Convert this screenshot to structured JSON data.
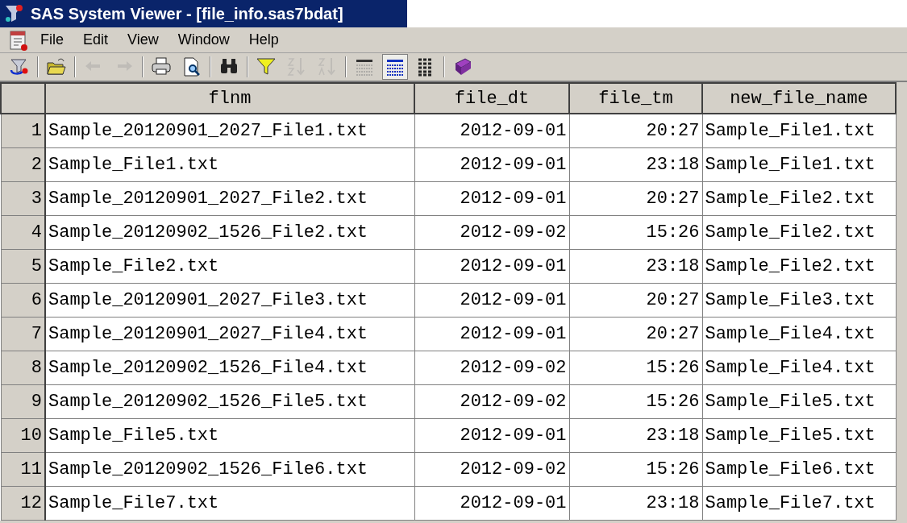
{
  "window": {
    "title": "SAS System Viewer - [file_info.sas7bdat]"
  },
  "menu": [
    "File",
    "Edit",
    "View",
    "Window",
    "Help"
  ],
  "toolbar": [
    {
      "kind": "explorer",
      "disabled": false
    },
    {
      "kind": "sep"
    },
    {
      "kind": "open",
      "disabled": false
    },
    {
      "kind": "sep"
    },
    {
      "kind": "back",
      "disabled": true
    },
    {
      "kind": "forward",
      "disabled": true
    },
    {
      "kind": "sep"
    },
    {
      "kind": "print",
      "disabled": false
    },
    {
      "kind": "preview",
      "disabled": false
    },
    {
      "kind": "sep"
    },
    {
      "kind": "find",
      "disabled": false
    },
    {
      "kind": "sep"
    },
    {
      "kind": "filter",
      "disabled": false
    },
    {
      "kind": "sortasc",
      "disabled": true
    },
    {
      "kind": "sortdesc",
      "disabled": true
    },
    {
      "kind": "sep"
    },
    {
      "kind": "viewlabels",
      "selected": false
    },
    {
      "kind": "viewnames",
      "selected": true
    },
    {
      "kind": "viewgrid",
      "selected": false
    },
    {
      "kind": "sep"
    },
    {
      "kind": "help",
      "disabled": false
    }
  ],
  "table": {
    "columns": [
      "",
      "flnm",
      "file_dt",
      "file_tm",
      "new_file_name"
    ],
    "rows": [
      [
        "1",
        "Sample_20120901_2027_File1.txt",
        "2012-09-01",
        "20:27",
        "Sample_File1.txt"
      ],
      [
        "2",
        "Sample_File1.txt",
        "2012-09-01",
        "23:18",
        "Sample_File1.txt"
      ],
      [
        "3",
        "Sample_20120901_2027_File2.txt",
        "2012-09-01",
        "20:27",
        "Sample_File2.txt"
      ],
      [
        "4",
        "Sample_20120902_1526_File2.txt",
        "2012-09-02",
        "15:26",
        "Sample_File2.txt"
      ],
      [
        "5",
        "Sample_File2.txt",
        "2012-09-01",
        "23:18",
        "Sample_File2.txt"
      ],
      [
        "6",
        "Sample_20120901_2027_File3.txt",
        "2012-09-01",
        "20:27",
        "Sample_File3.txt"
      ],
      [
        "7",
        "Sample_20120901_2027_File4.txt",
        "2012-09-01",
        "20:27",
        "Sample_File4.txt"
      ],
      [
        "8",
        "Sample_20120902_1526_File4.txt",
        "2012-09-02",
        "15:26",
        "Sample_File4.txt"
      ],
      [
        "9",
        "Sample_20120902_1526_File5.txt",
        "2012-09-02",
        "15:26",
        "Sample_File5.txt"
      ],
      [
        "10",
        "Sample_File5.txt",
        "2012-09-01",
        "23:18",
        "Sample_File5.txt"
      ],
      [
        "11",
        "Sample_20120902_1526_File6.txt",
        "2012-09-02",
        "15:26",
        "Sample_File6.txt"
      ],
      [
        "12",
        "Sample_File7.txt",
        "2012-09-01",
        "23:18",
        "Sample_File7.txt"
      ]
    ]
  }
}
